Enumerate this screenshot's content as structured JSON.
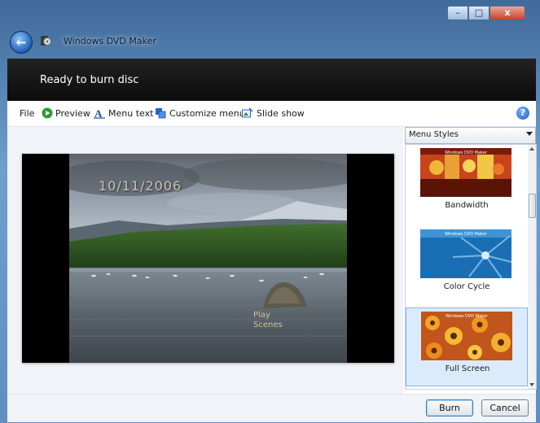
{
  "window": {
    "title": "Windows DVD Maker",
    "controls": {
      "minimize": "–",
      "maximize": "□",
      "close": "x"
    }
  },
  "status": {
    "text": "Ready to burn disc"
  },
  "toolbar": {
    "file": "File",
    "preview": "Preview",
    "menu_text": "Menu text",
    "customize_menu": "Customize menu",
    "slide_show": "Slide show",
    "help": "?"
  },
  "preview": {
    "date": "10/11/2006",
    "play_line1": "Play",
    "play_line2": "Scenes"
  },
  "menu_styles": {
    "dropdown_label": "Menu Styles",
    "thumb_title": "Windows DVD Maker",
    "items": [
      {
        "label": "Bandwidth"
      },
      {
        "label": "Color Cycle"
      },
      {
        "label": "Full Screen"
      }
    ]
  },
  "buttons": {
    "burn": "Burn",
    "cancel": "Cancel"
  }
}
